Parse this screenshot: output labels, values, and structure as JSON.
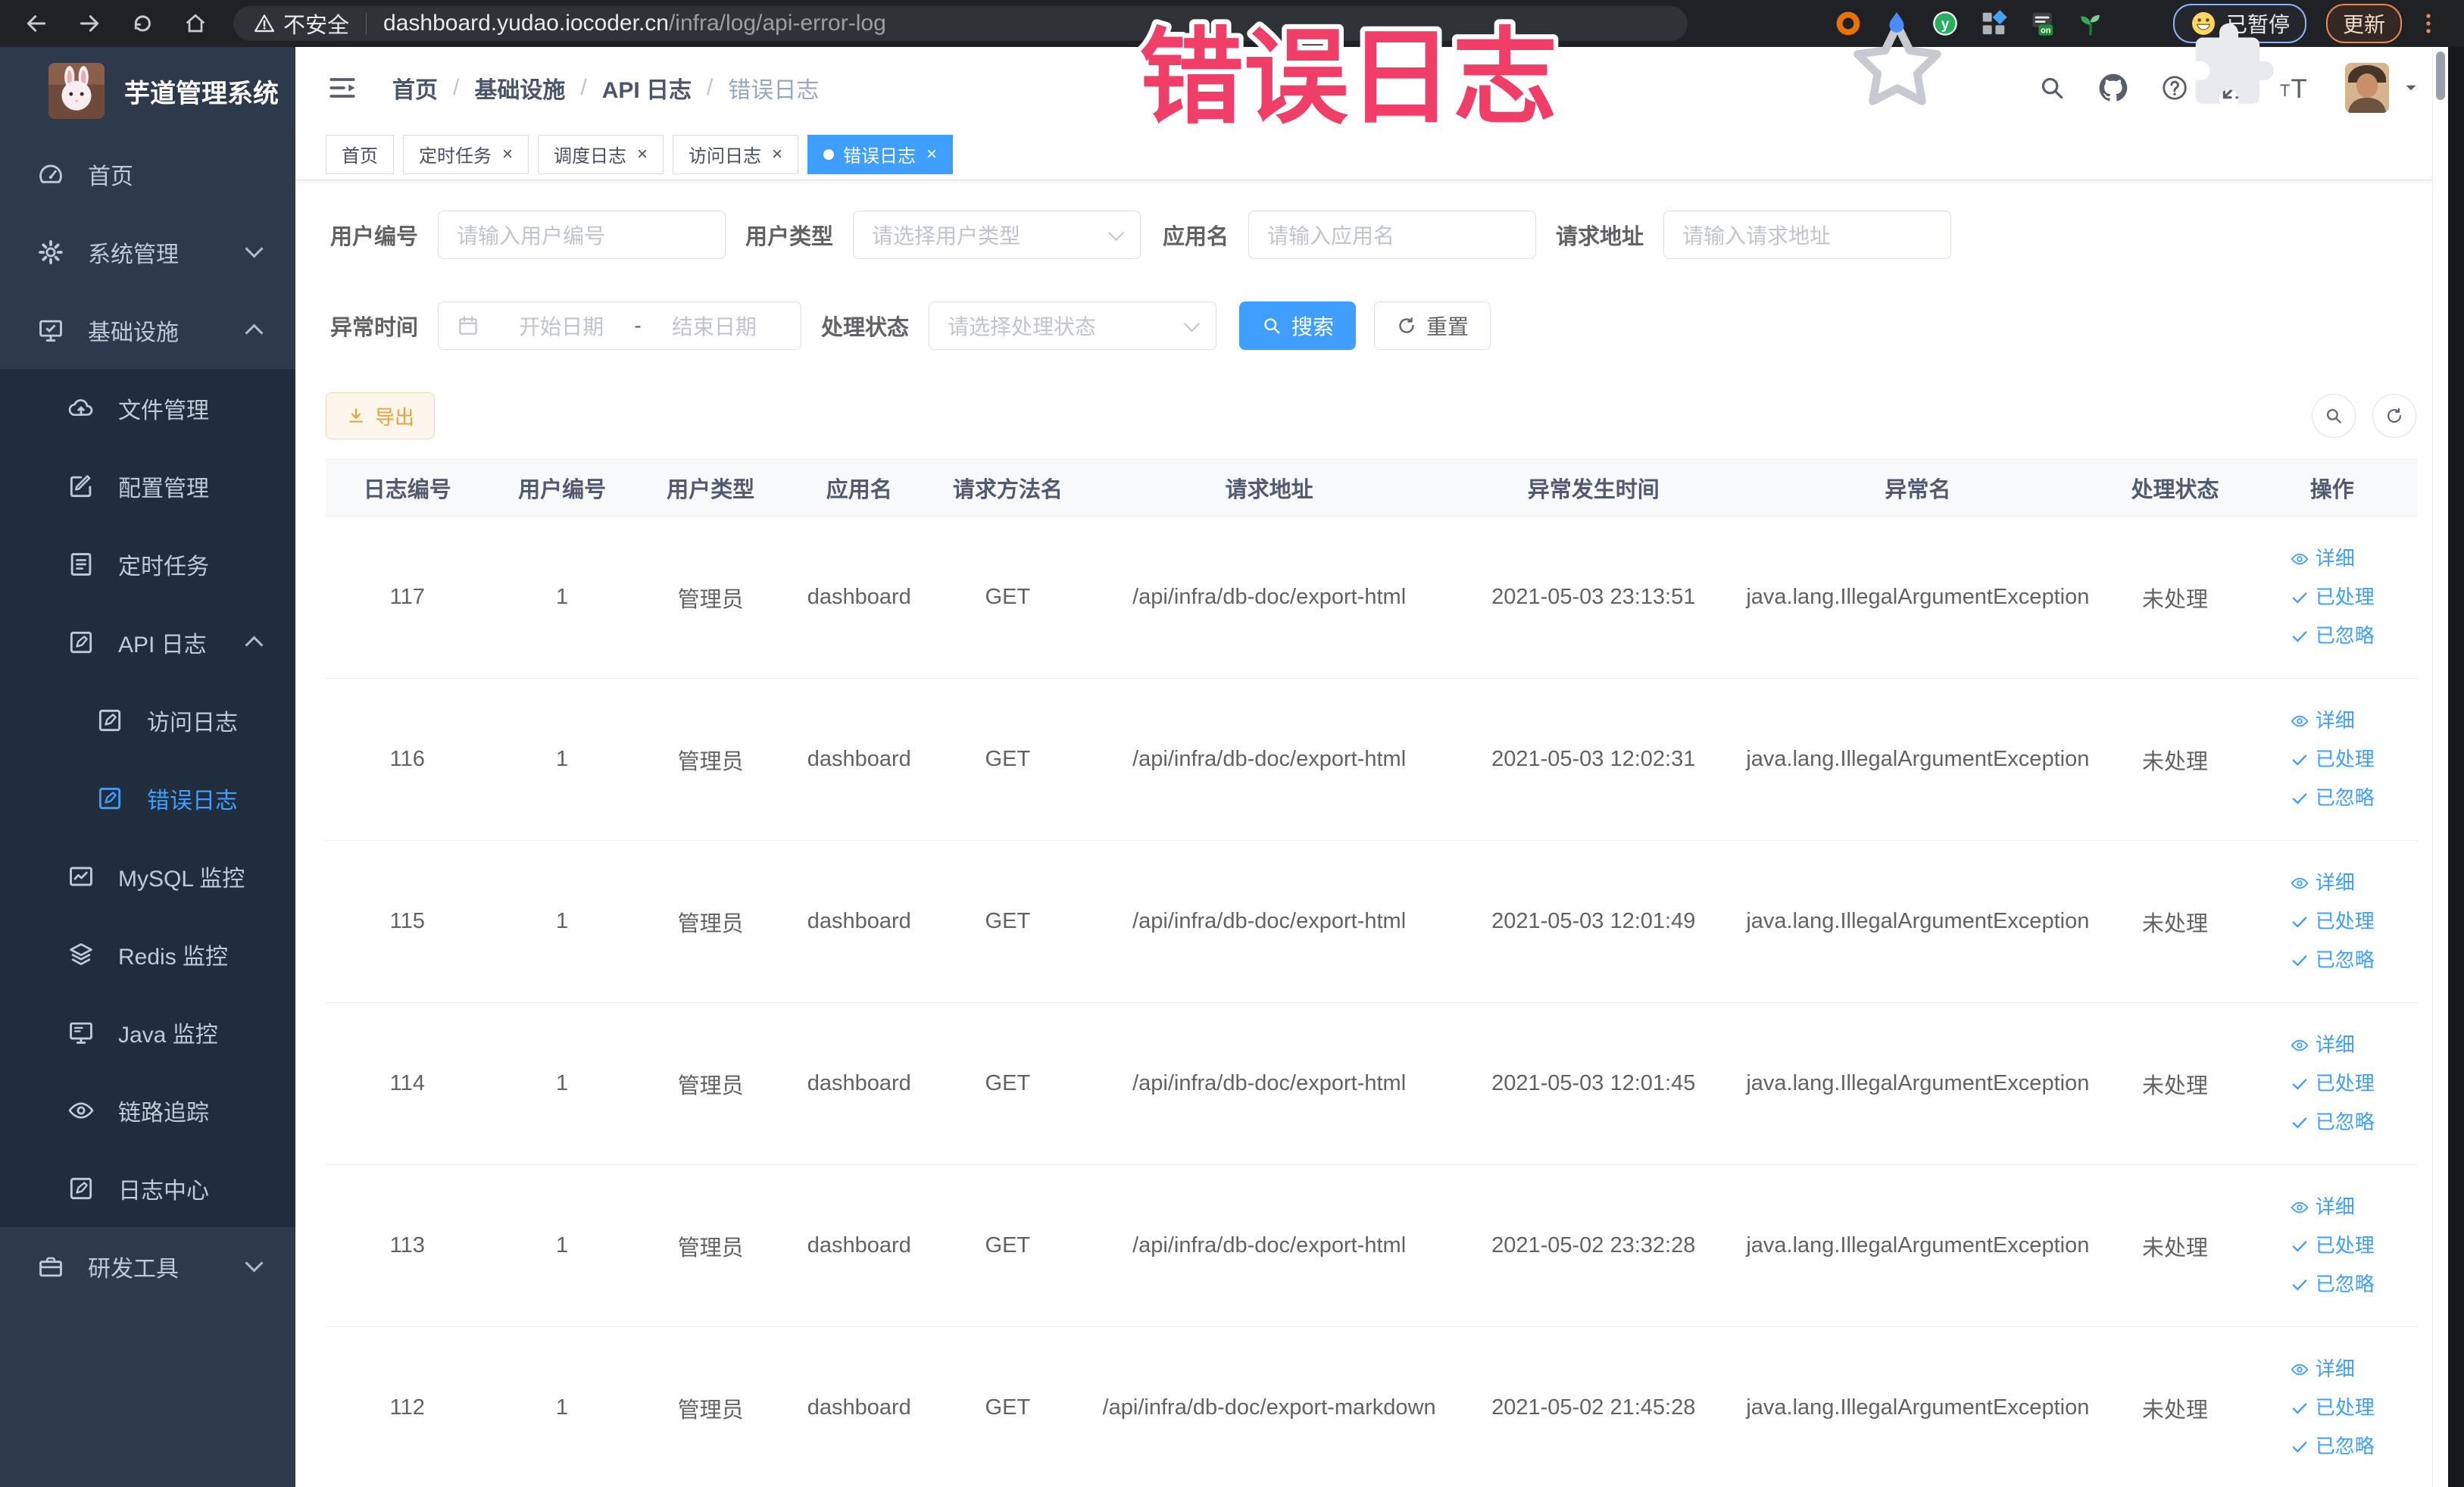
{
  "annotation": {
    "text": "错误日志",
    "color": "#ef3f68"
  },
  "browser": {
    "security_label": "不安全",
    "url_host": "dashboard.yudao.iocoder.cn",
    "url_path": "/infra/log/api-error-log",
    "paused_label": "已暂停",
    "update_label": "更新"
  },
  "sidebar": {
    "title": "芋道管理系统",
    "items": [
      {
        "label": "首页",
        "icon": "dashboard",
        "level": 1
      },
      {
        "label": "系统管理",
        "icon": "gear",
        "level": 1,
        "chevron": "down"
      },
      {
        "label": "基础设施",
        "icon": "infra",
        "level": 1,
        "chevron": "up"
      },
      {
        "label": "文件管理",
        "icon": "cloud",
        "level": 2
      },
      {
        "label": "配置管理",
        "icon": "edit",
        "level": 2
      },
      {
        "label": "定时任务",
        "icon": "list",
        "level": 2
      },
      {
        "label": "API 日志",
        "icon": "log",
        "level": 2,
        "chevron": "up"
      },
      {
        "label": "访问日志",
        "icon": "log",
        "level": 3
      },
      {
        "label": "错误日志",
        "icon": "log",
        "level": 3,
        "active": true
      },
      {
        "label": "MySQL 监控",
        "icon": "chart",
        "level": 2
      },
      {
        "label": "Redis 监控",
        "icon": "layers",
        "level": 2
      },
      {
        "label": "Java 监控",
        "icon": "screen",
        "level": 2
      },
      {
        "label": "链路追踪",
        "icon": "eye",
        "level": 2
      },
      {
        "label": "日志中心",
        "icon": "log",
        "level": 2
      },
      {
        "label": "研发工具",
        "icon": "toolbox",
        "level": 1,
        "chevron": "down"
      }
    ]
  },
  "header": {
    "breadcrumb": [
      "首页",
      "基础设施",
      "API 日志",
      "错误日志"
    ]
  },
  "tabs": [
    {
      "label": "首页",
      "closable": false,
      "active": false
    },
    {
      "label": "定时任务",
      "closable": true,
      "active": false
    },
    {
      "label": "调度日志",
      "closable": true,
      "active": false
    },
    {
      "label": "访问日志",
      "closable": true,
      "active": false
    },
    {
      "label": "错误日志",
      "closable": true,
      "active": true
    }
  ],
  "filters": {
    "user_id": {
      "label": "用户编号",
      "placeholder": "请输入用户编号"
    },
    "user_type": {
      "label": "用户类型",
      "placeholder": "请选择用户类型"
    },
    "app_name": {
      "label": "应用名",
      "placeholder": "请输入应用名"
    },
    "request_url": {
      "label": "请求地址",
      "placeholder": "请输入请求地址"
    },
    "exception_time": {
      "label": "异常时间",
      "start_placeholder": "开始日期",
      "separator": "-",
      "end_placeholder": "结束日期"
    },
    "process_status": {
      "label": "处理状态",
      "placeholder": "请选择处理状态"
    },
    "search_label": "搜索",
    "reset_label": "重置"
  },
  "toolbar": {
    "export_label": "导出"
  },
  "table": {
    "columns": [
      "日志编号",
      "用户编号",
      "用户类型",
      "应用名",
      "请求方法名",
      "请求地址",
      "异常发生时间",
      "异常名",
      "处理状态",
      "操作"
    ],
    "row_actions": [
      "详细",
      "已处理",
      "已忽略"
    ],
    "rows": [
      {
        "log_id": "117",
        "user_id": "1",
        "user_type": "管理员",
        "app": "dashboard",
        "method": "GET",
        "url": "/api/infra/db-doc/export-html",
        "time": "2021-05-03 23:13:51",
        "exception": "java.lang.IllegalArgumentException",
        "status": "未处理"
      },
      {
        "log_id": "116",
        "user_id": "1",
        "user_type": "管理员",
        "app": "dashboard",
        "method": "GET",
        "url": "/api/infra/db-doc/export-html",
        "time": "2021-05-03 12:02:31",
        "exception": "java.lang.IllegalArgumentException",
        "status": "未处理"
      },
      {
        "log_id": "115",
        "user_id": "1",
        "user_type": "管理员",
        "app": "dashboard",
        "method": "GET",
        "url": "/api/infra/db-doc/export-html",
        "time": "2021-05-03 12:01:49",
        "exception": "java.lang.IllegalArgumentException",
        "status": "未处理"
      },
      {
        "log_id": "114",
        "user_id": "1",
        "user_type": "管理员",
        "app": "dashboard",
        "method": "GET",
        "url": "/api/infra/db-doc/export-html",
        "time": "2021-05-03 12:01:45",
        "exception": "java.lang.IllegalArgumentException",
        "status": "未处理"
      },
      {
        "log_id": "113",
        "user_id": "1",
        "user_type": "管理员",
        "app": "dashboard",
        "method": "GET",
        "url": "/api/infra/db-doc/export-html",
        "time": "2021-05-02 23:32:28",
        "exception": "java.lang.IllegalArgumentException",
        "status": "未处理"
      },
      {
        "log_id": "112",
        "user_id": "1",
        "user_type": "管理员",
        "app": "dashboard",
        "method": "GET",
        "url": "/api/infra/db-doc/export-markdown",
        "time": "2021-05-02 21:45:28",
        "exception": "java.lang.IllegalArgumentException",
        "status": "未处理"
      }
    ]
  },
  "colors": {
    "primary": "#409eff",
    "warning": "#e6a23c",
    "sidebar_bg": "#2d3a4b",
    "submenu_bg": "#1f2d3d",
    "annotation": "#ef3f68"
  }
}
